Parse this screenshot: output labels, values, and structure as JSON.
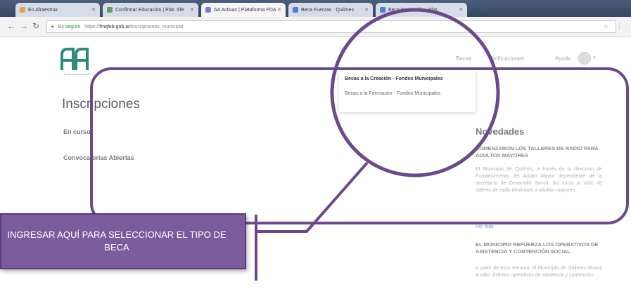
{
  "browser": {
    "tabs": [
      {
        "label": "En Afraestrux",
        "color": "#e6a23c"
      },
      {
        "label": "Confirmar Educación | Plat. Sfe",
        "color": "#56a35b"
      },
      {
        "label": "AA Activas | Plataforma FDA",
        "color": "#7a7fd1"
      },
      {
        "label": "Beca Fuerzas · Quilmes",
        "color": "#4a7fd1"
      },
      {
        "label": "Beca Formación · Plat.",
        "color": "#4a7fd1"
      }
    ],
    "address": {
      "secure_label": "Es seguro",
      "url_prefix": "https://",
      "url_host": "fmqfeb.gob.ar",
      "url_path": "/inscripciones_municipal"
    }
  },
  "site": {
    "logo_text": "Fondos Municipales Quilmes",
    "nav": [
      "Becas",
      "Notificaciones",
      "Ayuda"
    ]
  },
  "dropdown": {
    "items": [
      "Becas a la Creación - Fondos Municipales",
      "Becas a la Formación - Fondos Municipales"
    ]
  },
  "main": {
    "title": "Inscripciones",
    "links": [
      "En curso",
      "Convocatorias Abiertas"
    ]
  },
  "news": {
    "title": "Novedades",
    "items": [
      {
        "headline": "COMENZARON LOS TALLERES DE RADIO PARA ADULTOS MAYORES",
        "body": "El Municipio de Quilmes, a través de la dirección de Fortalecimiento del Adulto Mayor dependiente de la secretaría de Desarrollo Social, dio inicio al ciclo de talleres de radio destinado a adultos mayores."
      },
      {
        "headline": "EL MUNICIPIO REFUERZA LOS OPERATIVOS DE ASISTENCIA Y CONTENCIÓN SOCIAL",
        "body": "A partir de esta semana, el Municipio de Quilmes llevará a cabo distintos operativos de asistencia y contención"
      }
    ],
    "more_label": "Ver más"
  },
  "annotation": {
    "callout_text": "INGRESAR AQUÍ PARA SELECCIONAR EL TIPO DE BECA",
    "color": "#7c5b9c"
  }
}
